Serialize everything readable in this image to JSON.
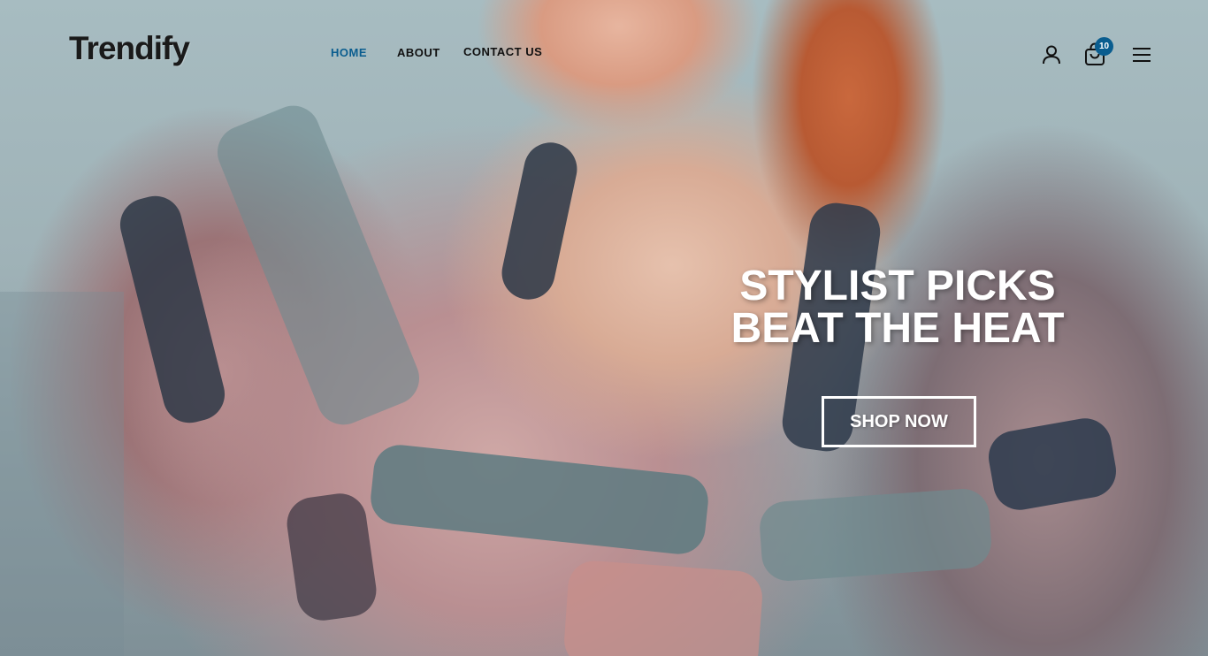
{
  "brand": {
    "logo_text": "Trendify"
  },
  "nav": {
    "items": [
      {
        "label": "HOME",
        "active": true
      },
      {
        "label": "ABOUT",
        "active": false
      },
      {
        "label": "CONTACT US",
        "active": false
      }
    ]
  },
  "header_actions": {
    "account_icon": "user-icon",
    "cart_icon": "shopping-bag-icon",
    "cart_count": "10",
    "menu_icon": "hamburger-menu-icon"
  },
  "hero": {
    "headline": "STYLIST PICKS BEAT THE HEAT",
    "cta_label": "SHOP NOW"
  },
  "colors": {
    "accent": "#0a5d8f",
    "text_dark": "#111111",
    "hero_text": "#ffffff"
  }
}
